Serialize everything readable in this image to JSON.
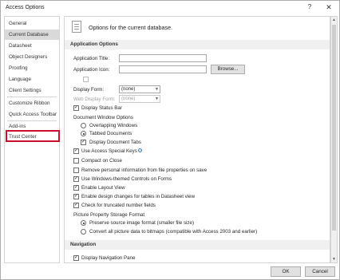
{
  "window": {
    "title": "Access Options",
    "help_label": "?",
    "close_label": "✕"
  },
  "sidebar": {
    "items": [
      {
        "label": "General"
      },
      {
        "label": "Current Database"
      },
      {
        "label": "Datasheet"
      },
      {
        "label": "Object Designers"
      },
      {
        "label": "Proofing"
      },
      {
        "label": "Language"
      },
      {
        "label": "Client Settings"
      },
      {
        "label": "Customize Ribbon"
      },
      {
        "label": "Quick Access Toolbar"
      },
      {
        "label": "Add-ins"
      },
      {
        "label": "Trust Center"
      }
    ],
    "selected_index": 1,
    "highlight_color": "#c8102e"
  },
  "main": {
    "header": "Options for the current database.",
    "sections": {
      "application_options": "Application Options",
      "navigation": "Navigation"
    },
    "fields": {
      "app_title_label": "Application Title:",
      "app_title_value": "",
      "app_icon_label": "Application Icon:",
      "app_icon_value": "",
      "browse_label": "Browse...",
      "use_as_form_icon": "Use as Form and Report Icon",
      "display_form_label": "Display Form:",
      "display_form_value": "(none)",
      "web_display_form_label": "Web Display Form:",
      "web_display_form_value": "(none)"
    },
    "options": {
      "display_status_bar": "Display Status Bar",
      "document_window_options": "Document Window Options",
      "overlapping_windows": "Overlapping Windows",
      "tabbed_documents": "Tabbed Documents",
      "display_document_tabs": "Display Document Tabs",
      "use_access_special_keys": "Use Access Special Keys",
      "compact_on_close": "Compact on Close",
      "remove_personal_info": "Remove personal information from file properties on save",
      "use_windows_themed_controls": "Use Windows-themed Controls on Forms",
      "enable_layout_view": "Enable Layout View",
      "enable_design_changes": "Enable design changes for tables in Datasheet view",
      "check_truncated_fields": "Check for truncated number fields",
      "picture_storage_format": "Picture Property Storage Format",
      "preserve_source_format": "Preserve source image format (smaller file size)",
      "convert_to_bitmaps": "Convert all picture data to bitmaps (compatible with Access 2003 and earlier)",
      "display_navigation_pane": "Display Navigation Pane"
    },
    "checked": {
      "use_as_form_icon": false,
      "display_status_bar": true,
      "overlapping_windows": false,
      "tabbed_documents": true,
      "display_document_tabs": true,
      "use_access_special_keys": true,
      "compact_on_close": false,
      "remove_personal_info": false,
      "use_windows_themed_controls": true,
      "enable_layout_view": true,
      "enable_design_changes": true,
      "check_truncated_fields": true,
      "preserve_source_format": true,
      "convert_to_bitmaps": false,
      "display_navigation_pane": true
    }
  },
  "footer": {
    "ok_label": "OK",
    "cancel_label": "Cancel"
  },
  "icons": {
    "header": "document-settings-icon",
    "info": "info-icon",
    "close": "close-icon",
    "help": "help-icon"
  }
}
